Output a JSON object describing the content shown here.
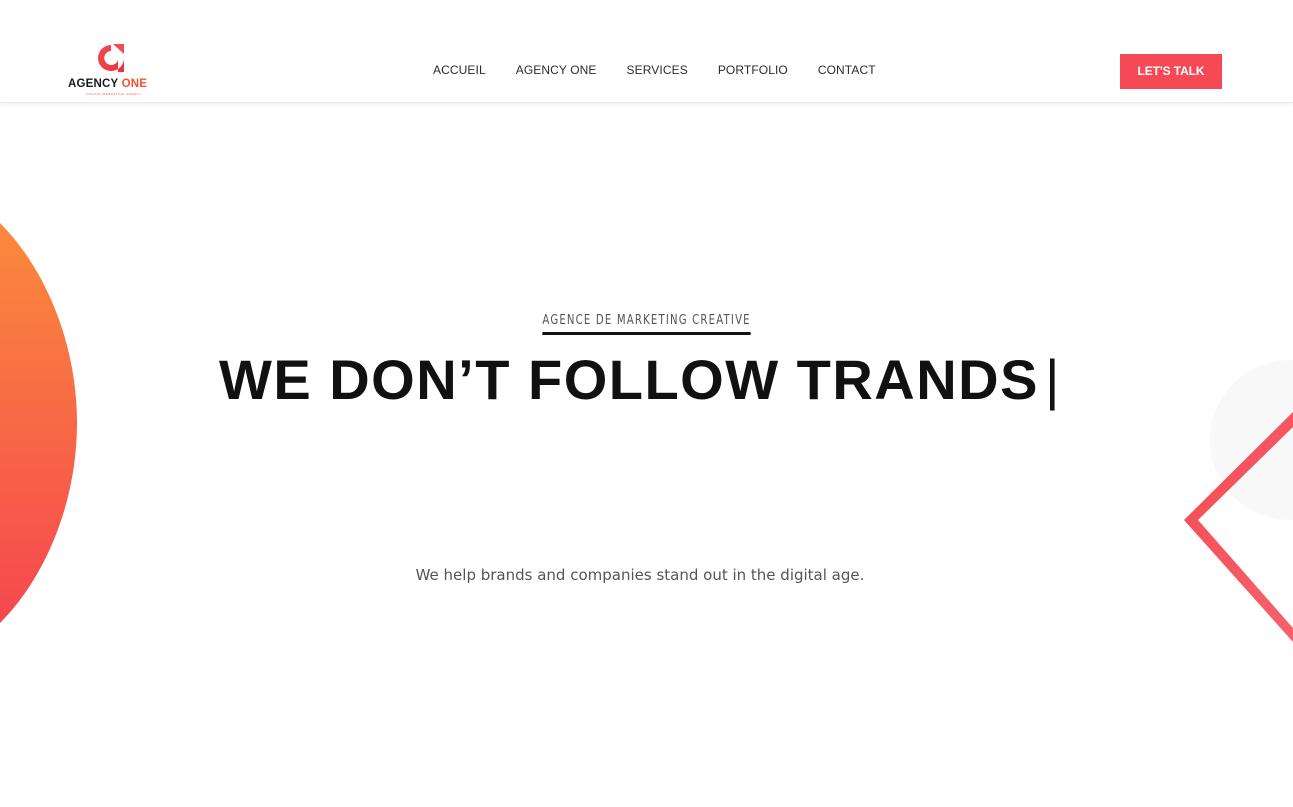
{
  "header": {
    "logo": {
      "mark_letter": "a",
      "name_part1": "AGENCY",
      "name_part2": "ONE",
      "tagline": "DIGITAL MARKETING AGENCY"
    },
    "nav": [
      {
        "label": "ACCUEIL"
      },
      {
        "label": "AGENCY ONE"
      },
      {
        "label": "SERVICES"
      },
      {
        "label": "PORTFOLIO"
      },
      {
        "label": "CONTACT"
      }
    ],
    "cta_label": "LET'S TALK"
  },
  "hero": {
    "eyebrow": "AGENCE DE MARKETING CREATIVE",
    "headline": "WE DON’T FOLLOW TRANDS",
    "cursor": "|",
    "subtitle": "We help brands and companies stand out in the digital age."
  },
  "colors": {
    "accent": "#f54a55",
    "orange": "#fb7f3e",
    "text_dark": "#111111"
  }
}
